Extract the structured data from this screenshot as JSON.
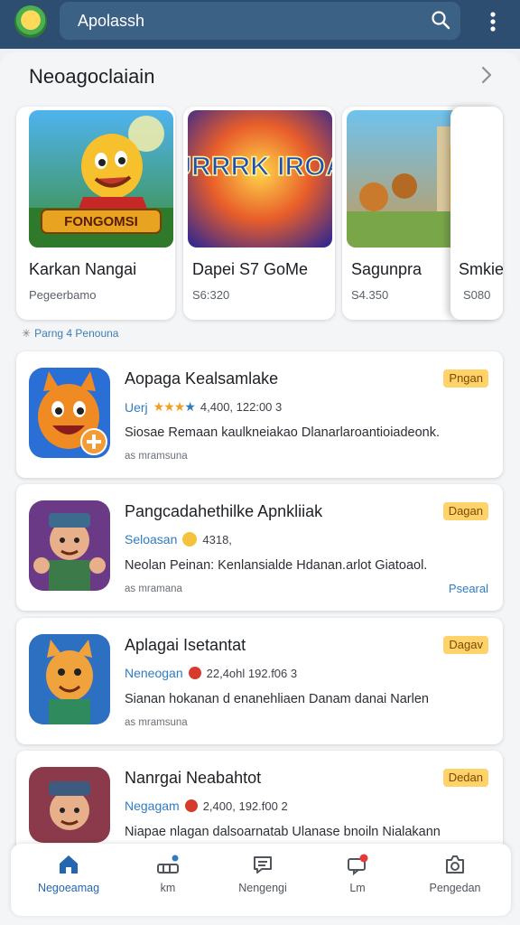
{
  "topbar": {
    "search_text": "Apolassh",
    "avatar_icon": "app-logo-icon",
    "search_icon": "search-icon",
    "more_icon": "more-vertical-icon",
    "bg_color": "#2d4e70"
  },
  "featured": {
    "title": "Neoagoclaiain",
    "chevron_icon": "chevron-right-icon",
    "items": [
      {
        "art_label": "FONGOMSI",
        "title": "Karkan Nangai",
        "sub": "Pegeerbamo"
      },
      {
        "art_label": "TURRRK IROAK",
        "title": "Dapei S7 GoMe",
        "sub": "S6:320"
      },
      {
        "art_label": "",
        "title": "Sagunpra",
        "sub": "S4.350"
      },
      {
        "art_label": "",
        "title": "Smkie",
        "sub": "S080"
      }
    ],
    "pager": "Parng 4 Penouna"
  },
  "apps": [
    {
      "name": "Aopaga Kealsamlake",
      "badge": "Pngan",
      "category": "Uerj",
      "rating_stars": 3,
      "stats": "4,400, 122:00 3",
      "description": "Siosae Remaan kaulkneiakao Dlanarlaroantioiadeonk.",
      "footer": "as mramsuna",
      "link": ""
    },
    {
      "name": "Pangcadahethilke Apnkliiak",
      "badge": "Dagan",
      "category": "Seloasan",
      "rating_stars": 0,
      "stats": "4318,",
      "description": "Neolan Peinan: Kenlansialde Hdanan.arlot Giatoaol.",
      "footer": "as mramana",
      "link": "Psearal"
    },
    {
      "name": "Aplagai Isetantat",
      "badge": "Dagav",
      "category": "Neneogan",
      "rating_stars": 0,
      "stats": "22,4ohl 192.f06 3",
      "description": "Sianan hokanan d enanehliaen Danam danai Narlen",
      "footer": "as mramsuna",
      "link": ""
    },
    {
      "name": "Nanrgai Neabahtot",
      "badge": "Dedan",
      "category": "Negagam",
      "rating_stars": 0,
      "stats": "2,400, 192.f00 2",
      "description": "Niapae nlagan dalsoarnatab Ulanase bnoiln Nialakann",
      "footer": "",
      "link": ""
    }
  ],
  "bottom_nav": [
    {
      "label": "Negoeamag",
      "icon": "home-icon",
      "active": true
    },
    {
      "label": "km",
      "icon": "stats-icon",
      "active": false
    },
    {
      "label": "Nengengi",
      "icon": "chat-icon",
      "active": false
    },
    {
      "label": "Lm",
      "icon": "notification-icon",
      "active": false
    },
    {
      "label": "Pengedan",
      "icon": "camera-icon",
      "active": false
    }
  ],
  "colors": {
    "accent": "#2f7cc0",
    "badge": "#ffd26a",
    "active_nav": "#2467b0"
  }
}
